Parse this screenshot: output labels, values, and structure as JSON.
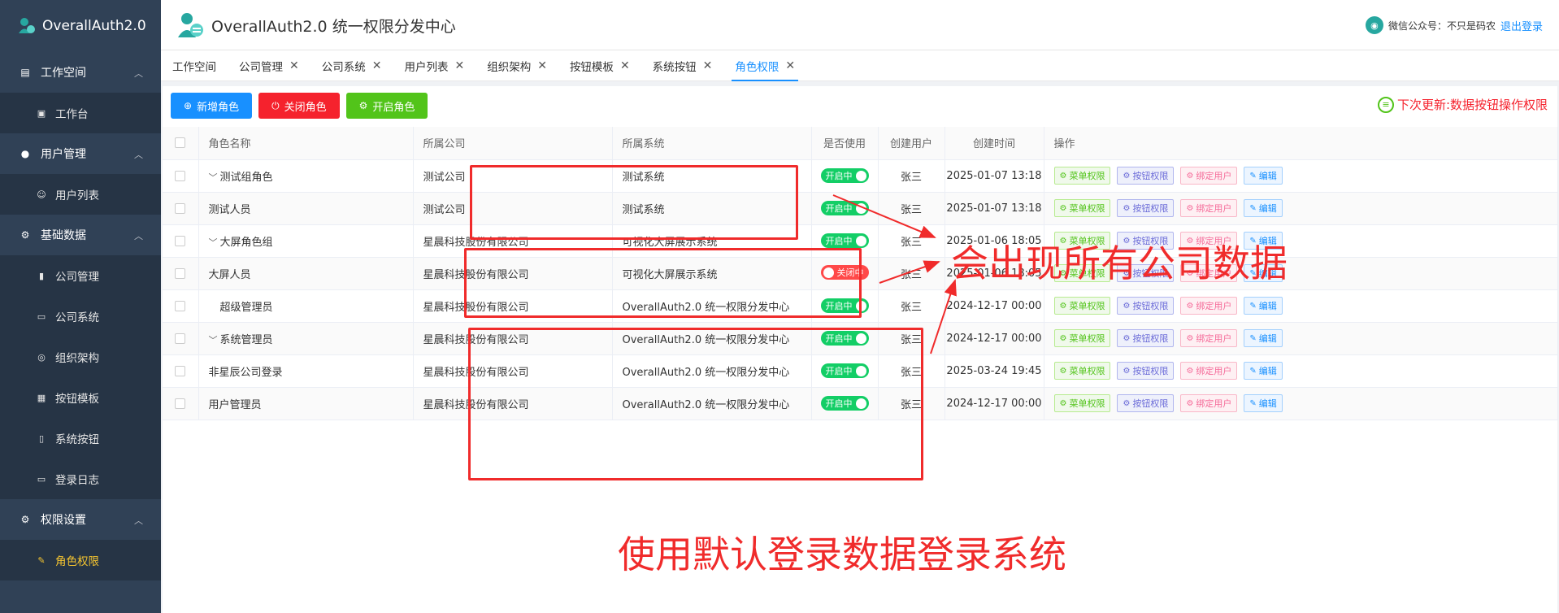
{
  "app": {
    "logo_text": "OverallAuth2.0",
    "header_title": "OverallAuth2.0 统一权限分发中心",
    "wechat_label": "微信公众号：不只是码农",
    "logout_label": "退出登录"
  },
  "sidebar": {
    "groups": [
      {
        "label": "工作空间",
        "icon": "workspace-icon",
        "items": [
          {
            "label": "工作台",
            "icon": "dashboard-icon"
          }
        ]
      },
      {
        "label": "用户管理",
        "icon": "user-icon",
        "items": [
          {
            "label": "用户列表",
            "icon": "person-icon"
          }
        ]
      },
      {
        "label": "基础数据",
        "icon": "gear-icon",
        "items": [
          {
            "label": "公司管理",
            "icon": "bar-chart-icon"
          },
          {
            "label": "公司系统",
            "icon": "monitor-icon"
          },
          {
            "label": "组织架构",
            "icon": "org-icon"
          },
          {
            "label": "按钮模板",
            "icon": "template-icon"
          },
          {
            "label": "系统按钮",
            "icon": "mouse-icon"
          },
          {
            "label": "登录日志",
            "icon": "log-icon"
          }
        ]
      },
      {
        "label": "权限设置",
        "icon": "gear-icon",
        "items": [
          {
            "label": "角色权限",
            "icon": "role-icon",
            "active": true
          }
        ]
      }
    ]
  },
  "tabs": [
    {
      "label": "工作空间",
      "closable": false
    },
    {
      "label": "公司管理",
      "closable": true
    },
    {
      "label": "公司系统",
      "closable": true
    },
    {
      "label": "用户列表",
      "closable": true
    },
    {
      "label": "组织架构",
      "closable": true
    },
    {
      "label": "按钮模板",
      "closable": true
    },
    {
      "label": "系统按钮",
      "closable": true
    },
    {
      "label": "角色权限",
      "closable": true,
      "active": true
    }
  ],
  "toolbar": {
    "add_label": "新增角色",
    "close_label": "关闭角色",
    "open_label": "开启角色",
    "next_update": "下次更新:数据按钮操作权限"
  },
  "table": {
    "headers": [
      "角色名称",
      "所属公司",
      "所属系统",
      "是否使用",
      "创建用户",
      "创建时间",
      "操作"
    ],
    "status_on": "开启中",
    "status_off": "关闭中",
    "actions": [
      "菜单权限",
      "按钮权限",
      "绑定用户",
      "编辑"
    ],
    "rows": [
      {
        "name": "测试组角色",
        "level": 0,
        "expand": true,
        "company": "测试公司",
        "system": "测试系统",
        "enabled": true,
        "user": "张三",
        "time": "2025-01-07 13:18"
      },
      {
        "name": "测试人员",
        "level": 1,
        "expand": false,
        "company": "测试公司",
        "system": "测试系统",
        "enabled": true,
        "user": "张三",
        "time": "2025-01-07 13:18"
      },
      {
        "name": "大屏角色组",
        "level": 0,
        "expand": true,
        "company": "星晨科技股份有限公司",
        "system": "可视化大屏展示系统",
        "enabled": true,
        "user": "张三",
        "time": "2025-01-06 18:05"
      },
      {
        "name": "大屏人员",
        "level": 1,
        "expand": false,
        "company": "星晨科技股份有限公司",
        "system": "可视化大屏展示系统",
        "enabled": false,
        "user": "张三",
        "time": "2025-01-06 18:05"
      },
      {
        "name": "超级管理员",
        "level": 0,
        "expand": false,
        "company": "星晨科技股份有限公司",
        "system": "OverallAuth2.0 统一权限分发中心",
        "enabled": true,
        "user": "张三",
        "time": "2024-12-17 00:00"
      },
      {
        "name": "系统管理员",
        "level": 0,
        "expand": true,
        "company": "星晨科技股份有限公司",
        "system": "OverallAuth2.0 统一权限分发中心",
        "enabled": true,
        "user": "张三",
        "time": "2024-12-17 00:00"
      },
      {
        "name": "非星辰公司登录",
        "level": 1,
        "expand": false,
        "company": "星晨科技股份有限公司",
        "system": "OverallAuth2.0 统一权限分发中心",
        "enabled": true,
        "user": "张三",
        "time": "2025-03-24 19:45"
      },
      {
        "name": "用户管理员",
        "level": 1,
        "expand": false,
        "company": "星晨科技股份有限公司",
        "system": "OverallAuth2.0 统一权限分发中心",
        "enabled": true,
        "user": "张三",
        "time": "2024-12-17 00:00"
      }
    ]
  },
  "annotations": {
    "text_a": "会出现所有公司数据",
    "text_b": "使用默认登录数据登录系统",
    "color": "#f02b2b"
  }
}
